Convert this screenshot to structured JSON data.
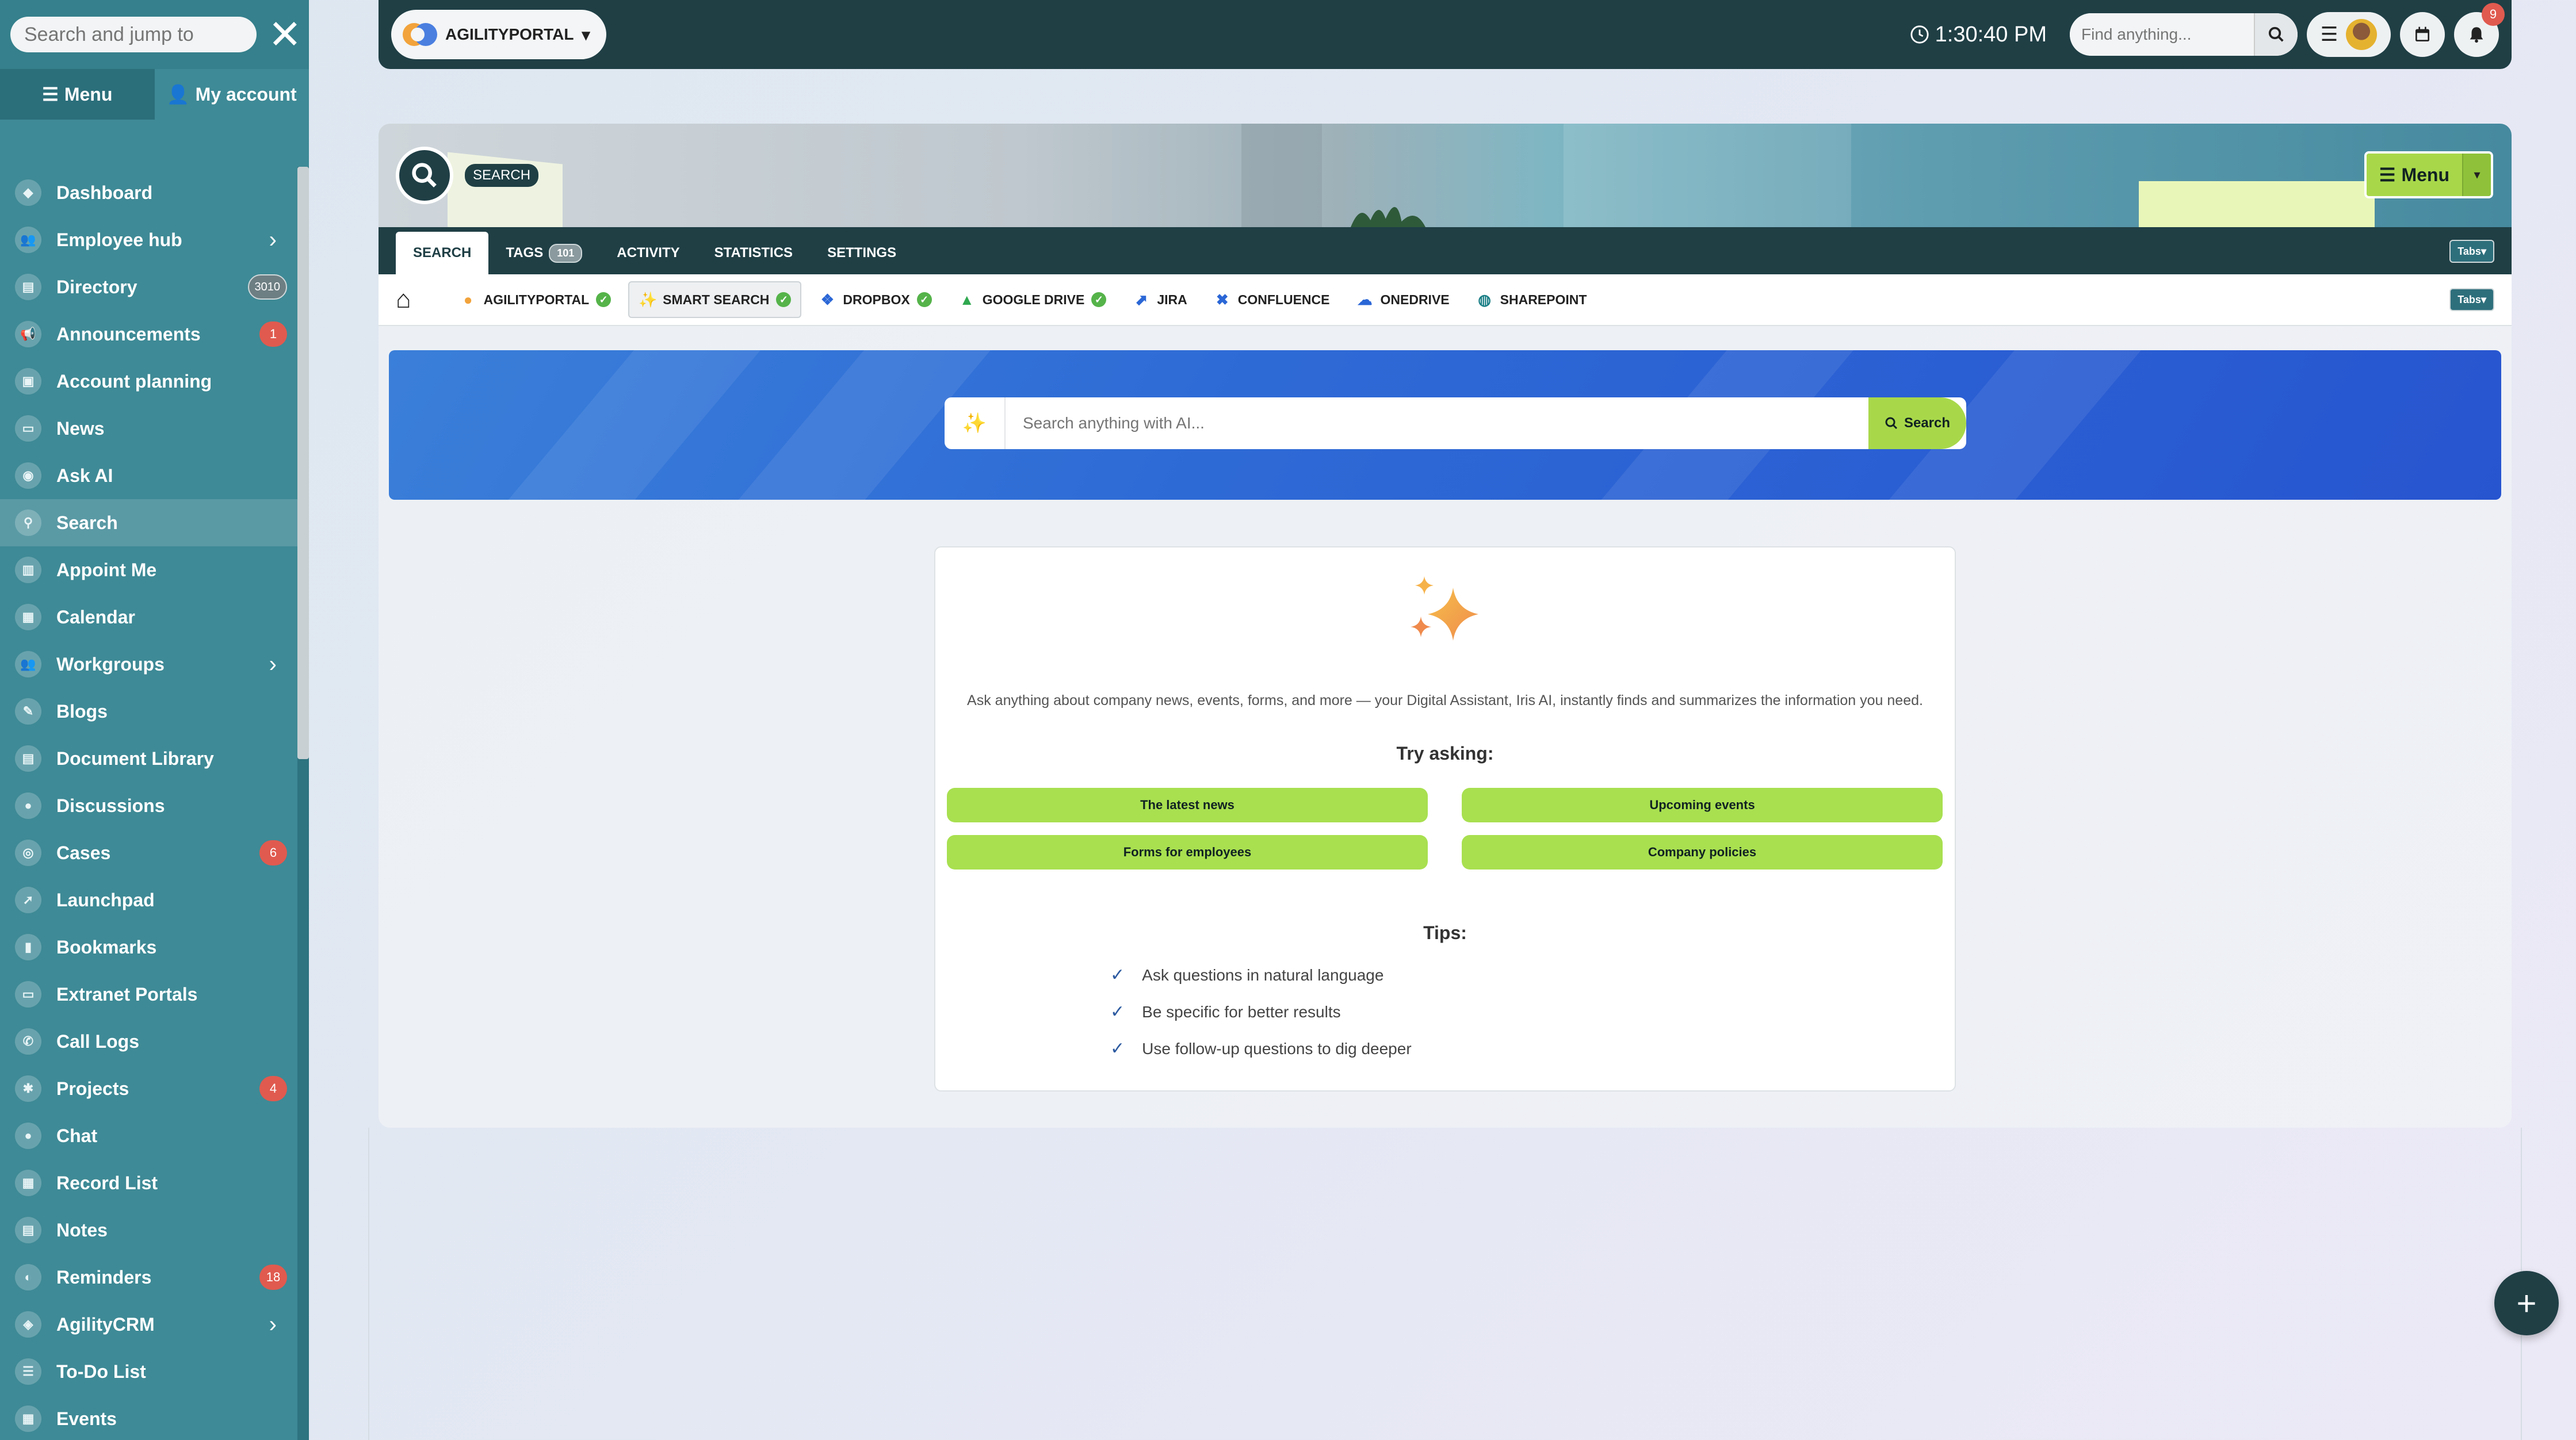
{
  "sidebar": {
    "search_placeholder": "Search and jump to",
    "tabs": {
      "menu": "Menu",
      "account": "My account"
    },
    "items": [
      {
        "label": "Dashboard",
        "icon": "dashboard-icon"
      },
      {
        "label": "Employee hub",
        "icon": "users-icon",
        "chevron": true
      },
      {
        "label": "Directory",
        "icon": "directory-icon",
        "badge": "3010"
      },
      {
        "label": "Announcements",
        "icon": "megaphone-icon",
        "badge": "1"
      },
      {
        "label": "Account planning",
        "icon": "id-card-icon"
      },
      {
        "label": "News",
        "icon": "news-icon"
      },
      {
        "label": "Ask AI",
        "icon": "robot-icon"
      },
      {
        "label": "Search",
        "icon": "search-icon",
        "active": true
      },
      {
        "label": "Appoint Me",
        "icon": "appointment-icon"
      },
      {
        "label": "Calendar",
        "icon": "calendar-icon"
      },
      {
        "label": "Workgroups",
        "icon": "group-icon",
        "chevron": true
      },
      {
        "label": "Blogs",
        "icon": "blog-icon"
      },
      {
        "label": "Document Library",
        "icon": "document-icon"
      },
      {
        "label": "Discussions",
        "icon": "discussion-icon"
      },
      {
        "label": "Cases",
        "icon": "cases-icon",
        "badge": "6"
      },
      {
        "label": "Launchpad",
        "icon": "rocket-icon"
      },
      {
        "label": "Bookmarks",
        "icon": "bookmark-icon"
      },
      {
        "label": "Extranet Portals",
        "icon": "portal-icon"
      },
      {
        "label": "Call Logs",
        "icon": "phone-icon"
      },
      {
        "label": "Projects",
        "icon": "projects-icon",
        "badge": "4"
      },
      {
        "label": "Chat",
        "icon": "chat-icon"
      },
      {
        "label": "Record List",
        "icon": "record-list-icon"
      },
      {
        "label": "Notes",
        "icon": "notes-icon"
      },
      {
        "label": "Reminders",
        "icon": "reminder-icon",
        "badge": "18"
      },
      {
        "label": "AgilityCRM",
        "icon": "crm-icon",
        "chevron": true
      },
      {
        "label": "To-Do List",
        "icon": "todo-icon"
      },
      {
        "label": "Events",
        "icon": "events-icon"
      }
    ]
  },
  "topbar": {
    "brand": "AGILITYPORTAL",
    "time": "1:30:40 PM",
    "find_placeholder": "Find anything...",
    "notification_count": "9"
  },
  "page": {
    "title": "SEARCH",
    "menu_button": "Menu",
    "tabs": [
      "SEARCH",
      "TAGS",
      "ACTIVITY",
      "STATISTICS",
      "SETTINGS"
    ],
    "tags_count": "101",
    "tabs_toggle": "Tabs",
    "sources": [
      {
        "label": "AGILITYPORTAL",
        "icon": "agilityportal-icon",
        "check": true
      },
      {
        "label": "SMART SEARCH",
        "icon": "sparkle-icon",
        "check": true,
        "active": true
      },
      {
        "label": "DROPBOX",
        "icon": "dropbox-icon",
        "check": true
      },
      {
        "label": "GOOGLE DRIVE",
        "icon": "google-drive-icon",
        "check": true
      },
      {
        "label": "JIRA",
        "icon": "jira-icon"
      },
      {
        "label": "CONFLUENCE",
        "icon": "confluence-icon"
      },
      {
        "label": "ONEDRIVE",
        "icon": "onedrive-icon"
      },
      {
        "label": "SHAREPOINT",
        "icon": "sharepoint-icon"
      }
    ]
  },
  "ai_search": {
    "placeholder": "Search anything with AI...",
    "button": "Search"
  },
  "card": {
    "description": "Ask anything about company news, events, forms, and more — your Digital Assistant, Iris AI, instantly finds and summarizes the information you need.",
    "try_heading": "Try asking:",
    "suggestions": [
      "The latest news",
      "Upcoming events",
      "Forms for employees",
      "Company policies"
    ],
    "tips_heading": "Tips:",
    "tips": [
      "Ask questions in natural language",
      "Be specific for better results",
      "Use follow-up questions to dig deeper"
    ]
  },
  "colors": {
    "sidebar": "#3e8a96",
    "topbar": "#1f3f45",
    "accent_green": "#a8d84a",
    "banner_blue": "#2e6ad6",
    "badge_red": "#e05a4f"
  }
}
